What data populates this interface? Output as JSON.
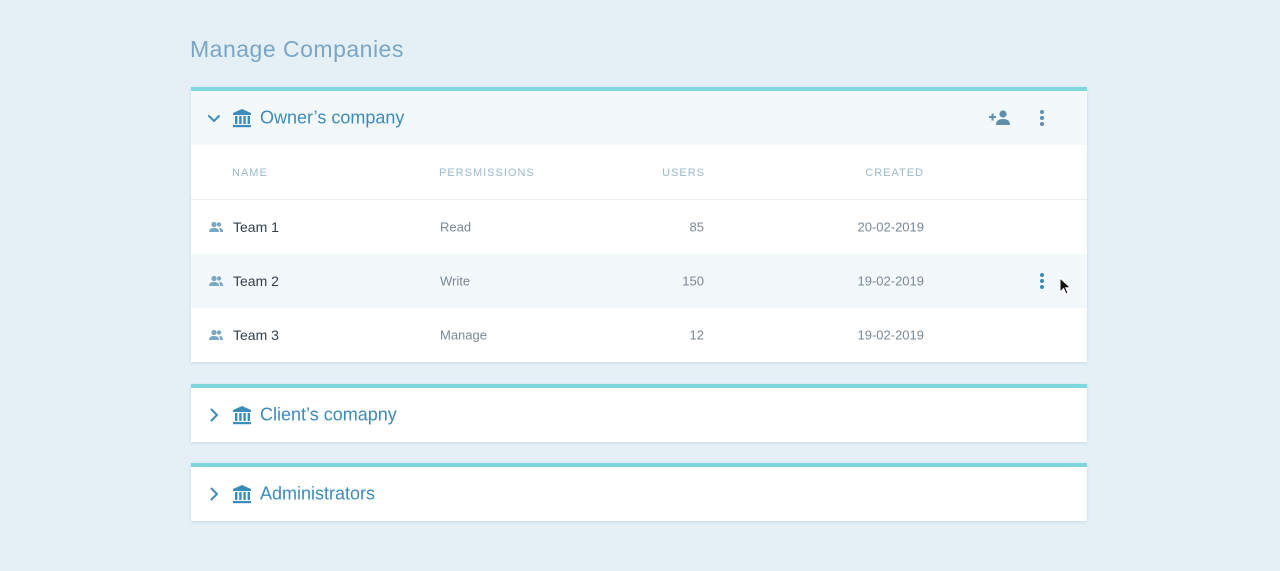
{
  "page": {
    "title": "Manage Companies"
  },
  "colors": {
    "background": "#e4eff6",
    "accent": "#7ed7df",
    "link": "#3d8bb8",
    "muted": "#9ab9cd"
  },
  "companies": [
    {
      "name": "Owner’s company",
      "expanded": true,
      "icon": "bank-icon",
      "actions": [
        "add-user-icon",
        "more-vert-icon"
      ],
      "table": {
        "columns": [
          "NAME",
          "PERSMISSIONS",
          "USERS",
          "CREATED"
        ],
        "rows": [
          {
            "name": "Team 1",
            "permission": "Read",
            "users": "85",
            "created": "20-02-2019"
          },
          {
            "name": "Team 2",
            "permission": "Write",
            "users": "150",
            "created": "19-02-2019"
          },
          {
            "name": "Team 3",
            "permission": "Manage",
            "users": "12",
            "created": "19-02-2019"
          }
        ]
      }
    },
    {
      "name": "Client’s comapny",
      "expanded": false,
      "icon": "bank-icon"
    },
    {
      "name": "Administrators",
      "expanded": false,
      "icon": "bank-icon"
    }
  ]
}
